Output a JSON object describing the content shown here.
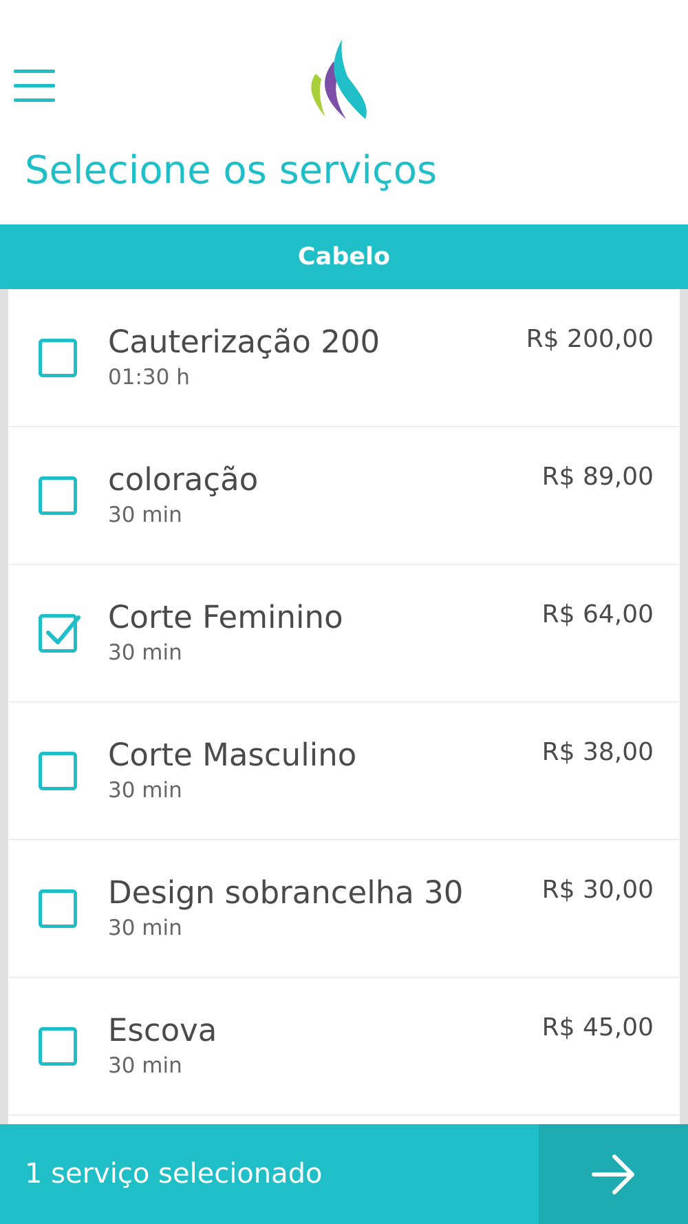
{
  "header": {
    "title": "Selecione os serviços"
  },
  "category": {
    "label": "Cabelo"
  },
  "services": [
    {
      "name": "Cauterização 200",
      "duration": "01:30 h",
      "price": "R$ 200,00",
      "checked": false
    },
    {
      "name": "coloração",
      "duration": "30 min",
      "price": "R$ 89,00",
      "checked": false
    },
    {
      "name": "Corte Feminino",
      "duration": "30 min",
      "price": "R$ 64,00",
      "checked": true
    },
    {
      "name": "Corte Masculino",
      "duration": "30 min",
      "price": "R$ 38,00",
      "checked": false
    },
    {
      "name": "Design sobrancelha 30",
      "duration": "30 min",
      "price": "R$ 30,00",
      "checked": false
    },
    {
      "name": "Escova",
      "duration": "30 min",
      "price": "R$ 45,00",
      "checked": false
    }
  ],
  "footer": {
    "summary": "1 serviço selecionado"
  },
  "colors": {
    "accent": "#20bfc7",
    "accent_dark": "#1eabb2",
    "logo_green": "#a8cf38",
    "logo_purple": "#7b4fa8",
    "logo_teal": "#20bfc7"
  },
  "icons": {
    "menu": "hamburger-menu-icon",
    "logo": "flame-logo-icon",
    "next": "arrow-right-icon",
    "check": "checkmark-icon"
  }
}
